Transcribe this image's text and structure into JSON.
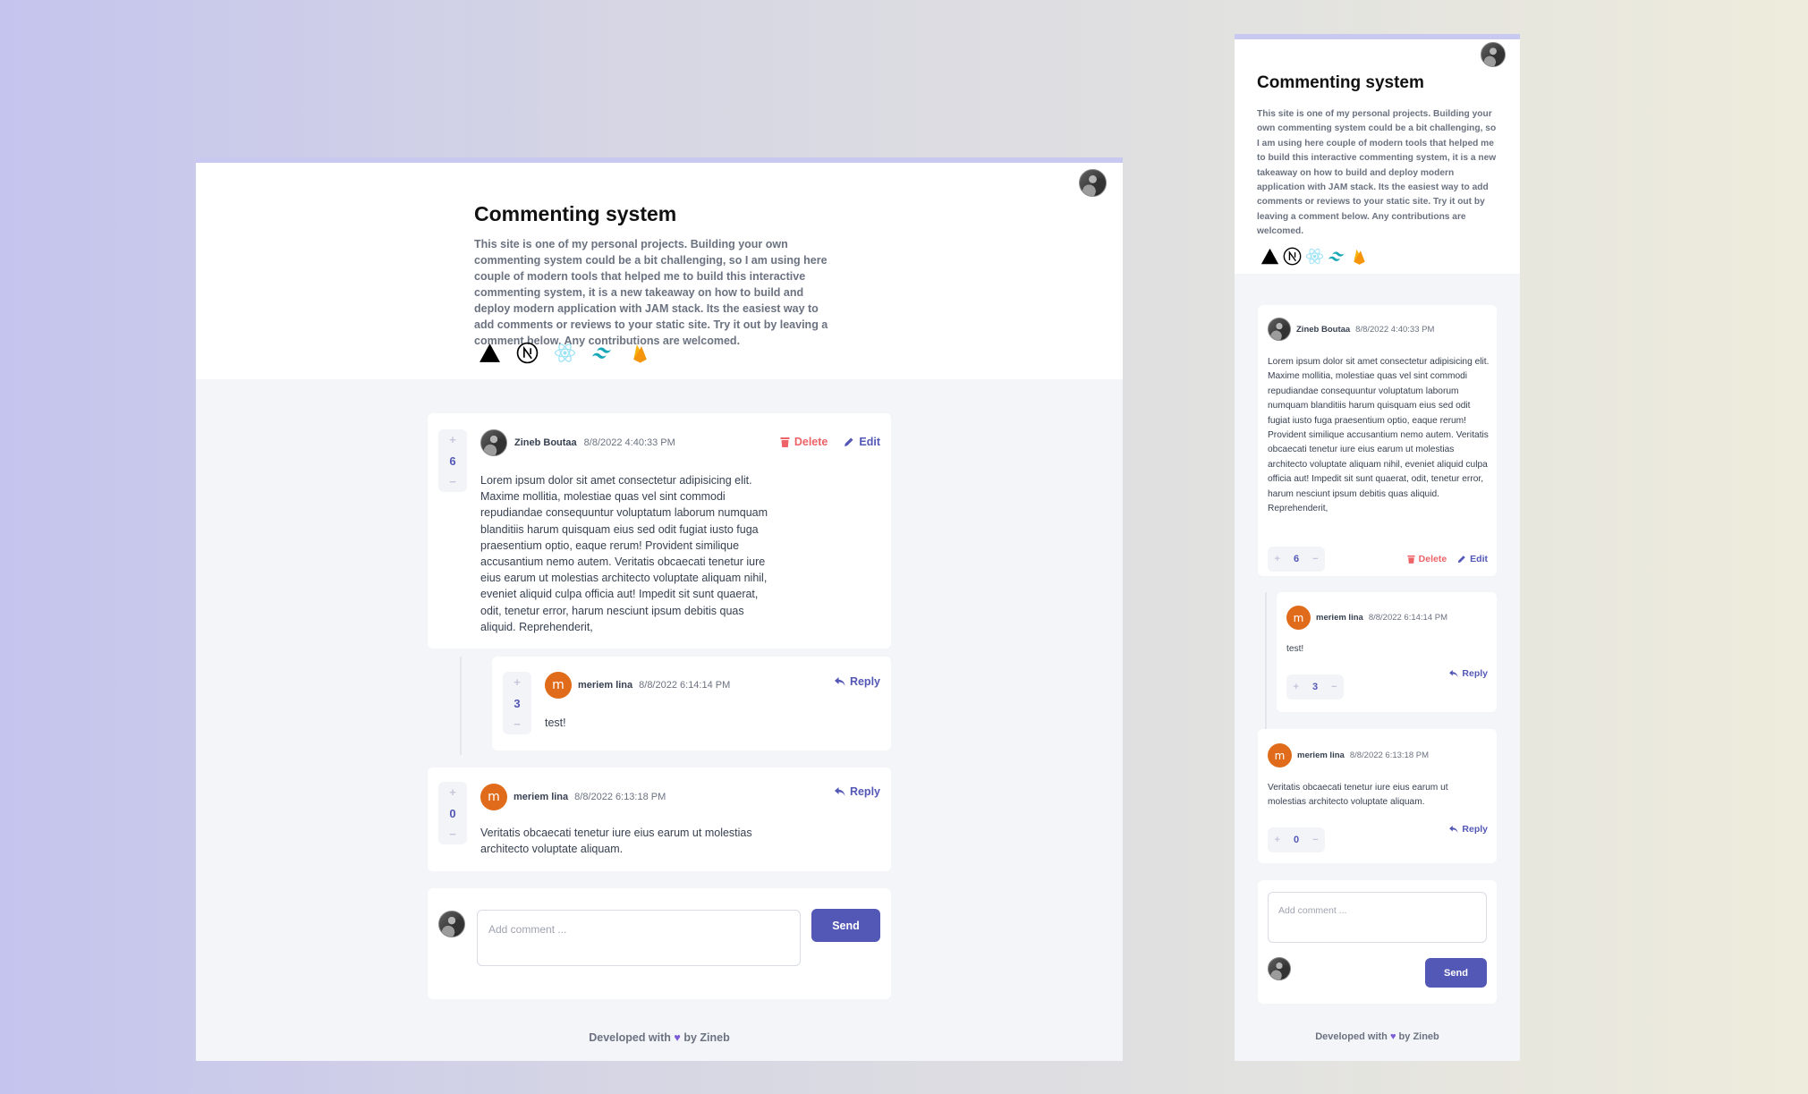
{
  "project": {
    "title": "Commenting system",
    "description": "This site is one of my personal projects. Building your own commenting system could be a bit challenging, so I am using here couple of modern tools that helped me to build this interactive commenting system, it is a new takeaway on how to build and deploy modern application with JAM stack. Its the easiest way to add comments or reviews to your static site. Try it out by leaving a comment below. Any contributions are welcomed.",
    "tech_icons": [
      "vercel-icon",
      "nextjs-icon",
      "react-icon",
      "tailwind-icon",
      "firebase-icon"
    ]
  },
  "comments": [
    {
      "author": "Zineb Boutaa",
      "date": "8/8/2022 4:40:33 PM",
      "avatar": "photo",
      "score": "6",
      "text": "Lorem ipsum dolor sit amet consectetur adipisicing elit. Maxime mollitia, molestiae quas vel sint commodi repudiandae consequuntur voluptatum laborum numquam blanditiis harum quisquam eius sed odit fugiat iusto fuga praesentium optio, eaque rerum! Provident similique accusantium nemo autem. Veritatis obcaecati tenetur iure eius earum ut molestias architecto voluptate aliquam nihil, eveniet aliquid culpa officia aut! Impedit sit sunt quaerat, odit, tenetur error, harum nesciunt ipsum debitis quas aliquid. Reprehenderit,",
      "actions": [
        "Delete",
        "Edit"
      ]
    },
    {
      "author": "meriem lina",
      "date": "8/8/2022 6:14:14 PM",
      "avatar": "m",
      "score": "3",
      "text": "test!",
      "actions": [
        "Reply"
      ],
      "is_reply": true
    },
    {
      "author": "meriem lina",
      "date": "8/8/2022 6:13:18 PM",
      "avatar": "m",
      "score": "0",
      "text": "Veritatis obcaecati tenetur iure eius earum ut molestias architecto voluptate aliquam.",
      "actions": [
        "Reply"
      ]
    }
  ],
  "vote": {
    "plus": "+",
    "minus": "−"
  },
  "composer": {
    "placeholder": "Add comment ...",
    "send_label": "Send"
  },
  "footer": {
    "prefix": "Developed with",
    "heart": "♥",
    "suffix": "by Zineb"
  },
  "colors": {
    "accent": "#5357b6",
    "danger": "#ed6368",
    "avatar_letter_bg": "#e06c1b",
    "top_border": "#c9c8f1"
  }
}
